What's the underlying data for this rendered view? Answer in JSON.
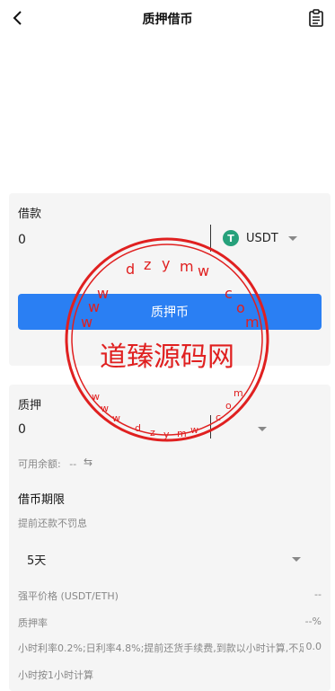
{
  "header": {
    "title": "质押借币"
  },
  "borrow": {
    "label": "借款",
    "amount": "0",
    "coin": {
      "symbol": "USDT",
      "icon_glyph": "T",
      "icon_color": "#26a17b"
    },
    "button_label": "质押币"
  },
  "pledge": {
    "label": "质押",
    "amount": "0",
    "available_label": "可用余额:",
    "available_value": "--",
    "swap_icon": "⇆"
  },
  "term": {
    "title": "借币期限",
    "subtitle": "提前还款不罚息",
    "selected": "5天"
  },
  "details": {
    "liq_price_label": "强平价格  (USDT/ETH)",
    "liq_price_value": "--",
    "pledge_rate_label": "质押率",
    "pledge_rate_value": "--%",
    "rate_line1": "小时利率0.2%;日利率4.8%;提前还货手续费,到款以小时计算,不足1",
    "rate_line1_value": "0.0",
    "rate_line2": "小时按1小时计算"
  },
  "watermark": {
    "text": "道臻源码网",
    "top_letters": [
      "d",
      "z",
      "y",
      "m",
      "w"
    ],
    "bottom_letters": [
      "d",
      "z",
      "y",
      "m",
      "w"
    ],
    "left_letters": [
      "w",
      "w",
      "w"
    ],
    "right_letters": [
      "c",
      "o",
      "m"
    ],
    "color": "#e02020"
  },
  "colors": {
    "primary": "#2a7ff3",
    "card_bg": "#f5f5f5",
    "usdt": "#26a17b"
  }
}
